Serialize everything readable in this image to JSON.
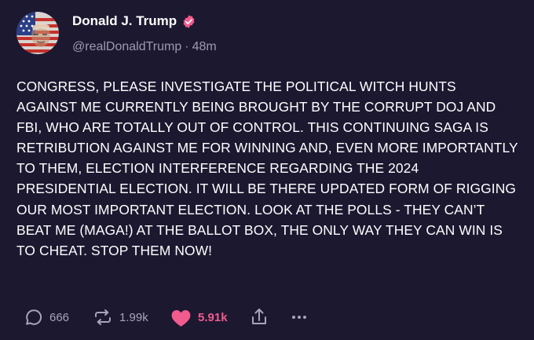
{
  "author": {
    "display_name": "Donald J. Trump",
    "handle": "@realDonaldTrump",
    "separator": "·",
    "time_ago": "48m",
    "verified": true,
    "verified_color": "#f25b8d"
  },
  "post": {
    "text": "CONGRESS, PLEASE INVESTIGATE THE POLITICAL WITCH HUNTS AGAINST ME CURRENTLY BEING BROUGHT BY THE CORRUPT DOJ AND FBI, WHO ARE TOTALLY OUT OF CONTROL. THIS CONTINUING SAGA IS RETRIBUTION AGAINST ME FOR WINNING AND, EVEN MORE IMPORTANTLY TO THEM, ELECTION INTERFERENCE REGARDING THE 2024 PRESIDENTIAL ELECTION. IT WILL BE THERE UPDATED FORM OF RIGGING OUR MOST IMPORTANT ELECTION. LOOK AT THE POLLS - THEY CAN’T BEAT ME (MAGA!) AT THE BALLOT BOX, THE ONLY WAY THEY CAN WIN IS TO CHEAT. STOP THEM NOW!"
  },
  "actions": {
    "replies": "666",
    "reposts": "1.99k",
    "likes": "5.91k",
    "liked": true,
    "like_color": "#f25b8d",
    "reply_icon": "comment-bubble-icon",
    "repost_icon": "repost-arrows-icon",
    "like_icon": "heart-icon",
    "share_icon": "share-upload-icon",
    "more_icon": "more-dots-icon"
  },
  "colors": {
    "background": "#1c1830",
    "text": "#ffffff",
    "muted": "#9e9aae"
  }
}
